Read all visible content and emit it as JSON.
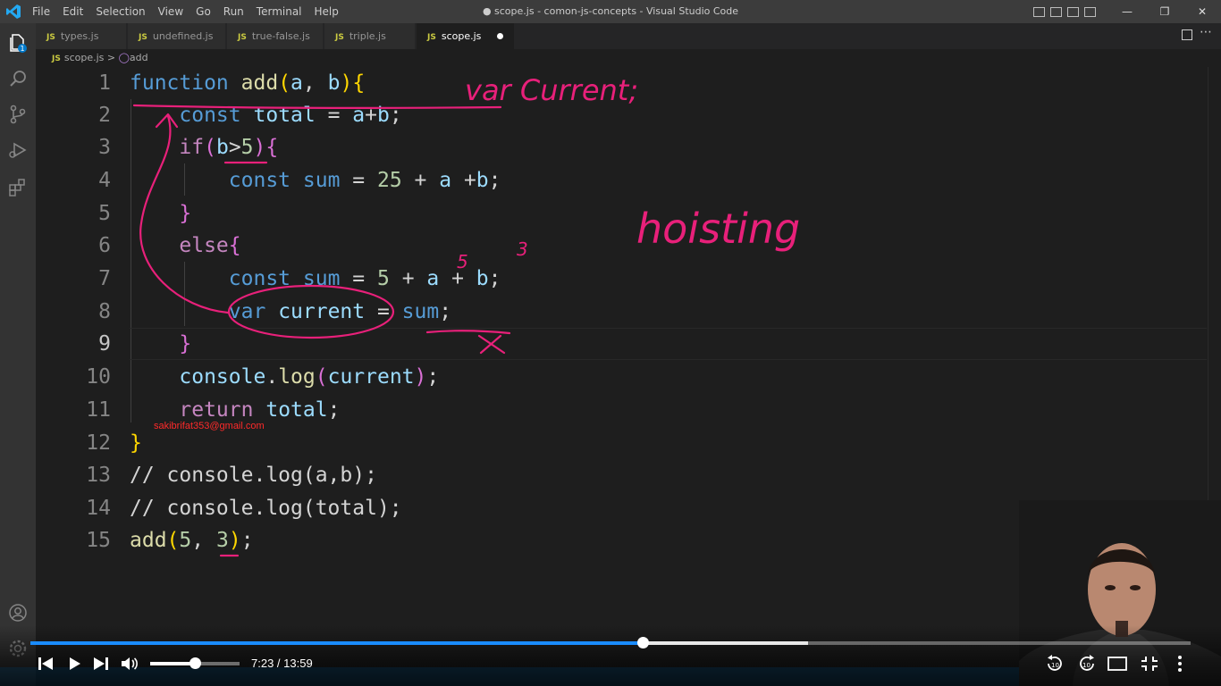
{
  "window": {
    "title": "● scope.js - comon-js-concepts - Visual Studio Code",
    "menu": [
      "File",
      "Edit",
      "Selection",
      "View",
      "Go",
      "Run",
      "Terminal",
      "Help"
    ]
  },
  "tabs": [
    {
      "label": "types.js",
      "icon": "JS"
    },
    {
      "label": "undefined.js",
      "icon": "JS"
    },
    {
      "label": "true-false.js",
      "icon": "JS"
    },
    {
      "label": "triple.js",
      "icon": "JS"
    },
    {
      "label": "scope.js",
      "icon": "JS",
      "active": true,
      "modified": true
    }
  ],
  "breadcrumb": {
    "file": "scope.js",
    "separator": ">",
    "symbol": "add"
  },
  "editor": {
    "current_line": 9,
    "line_numbers": [
      "1",
      "2",
      "3",
      "4",
      "5",
      "6",
      "7",
      "8",
      "9",
      "10",
      "11",
      "12",
      "13",
      "14",
      "15"
    ]
  },
  "overlay": {
    "email": "sakibrifat353@gmail.com",
    "handwriting": [
      "var Current;",
      "hoisting",
      "5",
      "3",
      "X"
    ]
  },
  "video_player": {
    "current_time": "7:23",
    "duration": "13:59",
    "time_text": "7:23 / 13:59",
    "played_fraction": 0.528,
    "buffered_fraction": 0.67,
    "volume_fraction": 0.5
  },
  "colors": {
    "accent": "#1a8cff",
    "annotation": "#e8207a",
    "editor_bg": "#1e1e1e",
    "keyword": "#569cd6",
    "function": "#dcdcaa",
    "comment": "#6a9955"
  }
}
